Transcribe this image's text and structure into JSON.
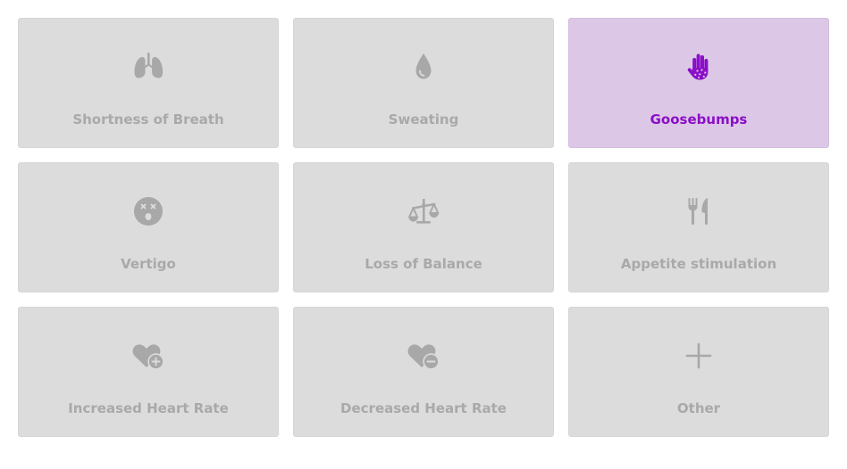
{
  "colors": {
    "tile_bg": "#dcdcdc",
    "tile_selected_bg": "#dcc8e6",
    "icon_inactive": "#a8a8a8",
    "accent": "#8a0fc7"
  },
  "symptoms": [
    {
      "label": "Shortness of Breath",
      "icon": "lungs-icon",
      "selected": false
    },
    {
      "label": "Sweating",
      "icon": "droplet-icon",
      "selected": false
    },
    {
      "label": "Goosebumps",
      "icon": "hand-dots-icon",
      "selected": true
    },
    {
      "label": "Vertigo",
      "icon": "dizzy-face-icon",
      "selected": false
    },
    {
      "label": "Loss of Balance",
      "icon": "scale-balanced-icon",
      "selected": false
    },
    {
      "label": "Appetite stimulation",
      "icon": "utensils-icon",
      "selected": false
    },
    {
      "label": "Increased Heart Rate",
      "icon": "heart-plus-icon",
      "selected": false
    },
    {
      "label": "Decreased Heart Rate",
      "icon": "heart-minus-icon",
      "selected": false
    },
    {
      "label": "Other",
      "icon": "plus-icon",
      "selected": false
    }
  ]
}
